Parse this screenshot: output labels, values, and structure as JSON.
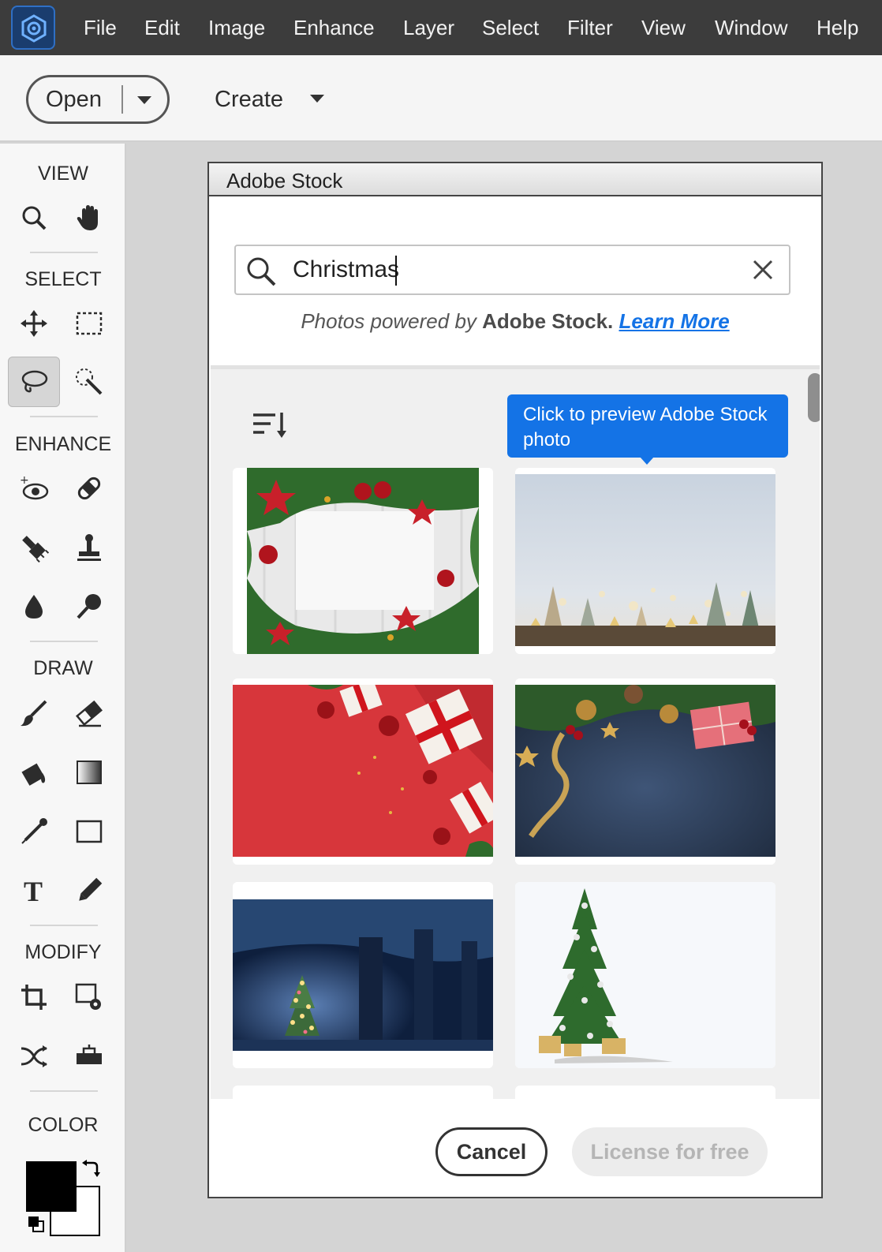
{
  "menubar": {
    "items": [
      "File",
      "Edit",
      "Image",
      "Enhance",
      "Layer",
      "Select",
      "Filter",
      "View",
      "Window",
      "Help"
    ]
  },
  "toolbar": {
    "open_label": "Open",
    "create_label": "Create"
  },
  "toolpanel": {
    "sections": {
      "view": "VIEW",
      "select": "SELECT",
      "enhance": "ENHANCE",
      "draw": "DRAW",
      "modify": "MODIFY",
      "color": "COLOR"
    },
    "tools": [
      "zoom-icon",
      "hand-icon",
      "move-icon",
      "marquee-icon",
      "lasso-icon",
      "quick-selection-icon",
      "red-eye-icon",
      "healing-icon",
      "smart-brush-icon",
      "clone-stamp-icon",
      "blur-icon",
      "sponge-icon",
      "brush-icon",
      "eraser-icon",
      "paint-bucket-icon",
      "gradient-icon",
      "eyedropper-icon",
      "shape-icon",
      "type-icon",
      "pencil-icon",
      "crop-icon",
      "recompose-icon",
      "content-aware-move-icon",
      "straighten-icon"
    ],
    "active_tool": "lasso-icon",
    "foreground_color": "#000000",
    "background_color": "#ffffff"
  },
  "dialog": {
    "title": "Adobe Stock",
    "search": {
      "value": "Christmas",
      "placeholder": ""
    },
    "powered": {
      "prefix": "Photos powered by",
      "brand": "Adobe Stock.",
      "link": "Learn More"
    },
    "tooltip": "Click to preview Adobe Stock photo",
    "photos": [
      "christmas-wreath-frame-photo",
      "christmas-trees-bokeh-photo",
      "red-gifts-ornaments-photo",
      "navy-gift-ornaments-photo",
      "snowy-forest-tree-photo",
      "decorated-tree-white-photo"
    ],
    "cancel_label": "Cancel",
    "license_label": "License for free"
  },
  "colors": {
    "accent": "#1473e6",
    "menubar": "#3c3c3c"
  }
}
